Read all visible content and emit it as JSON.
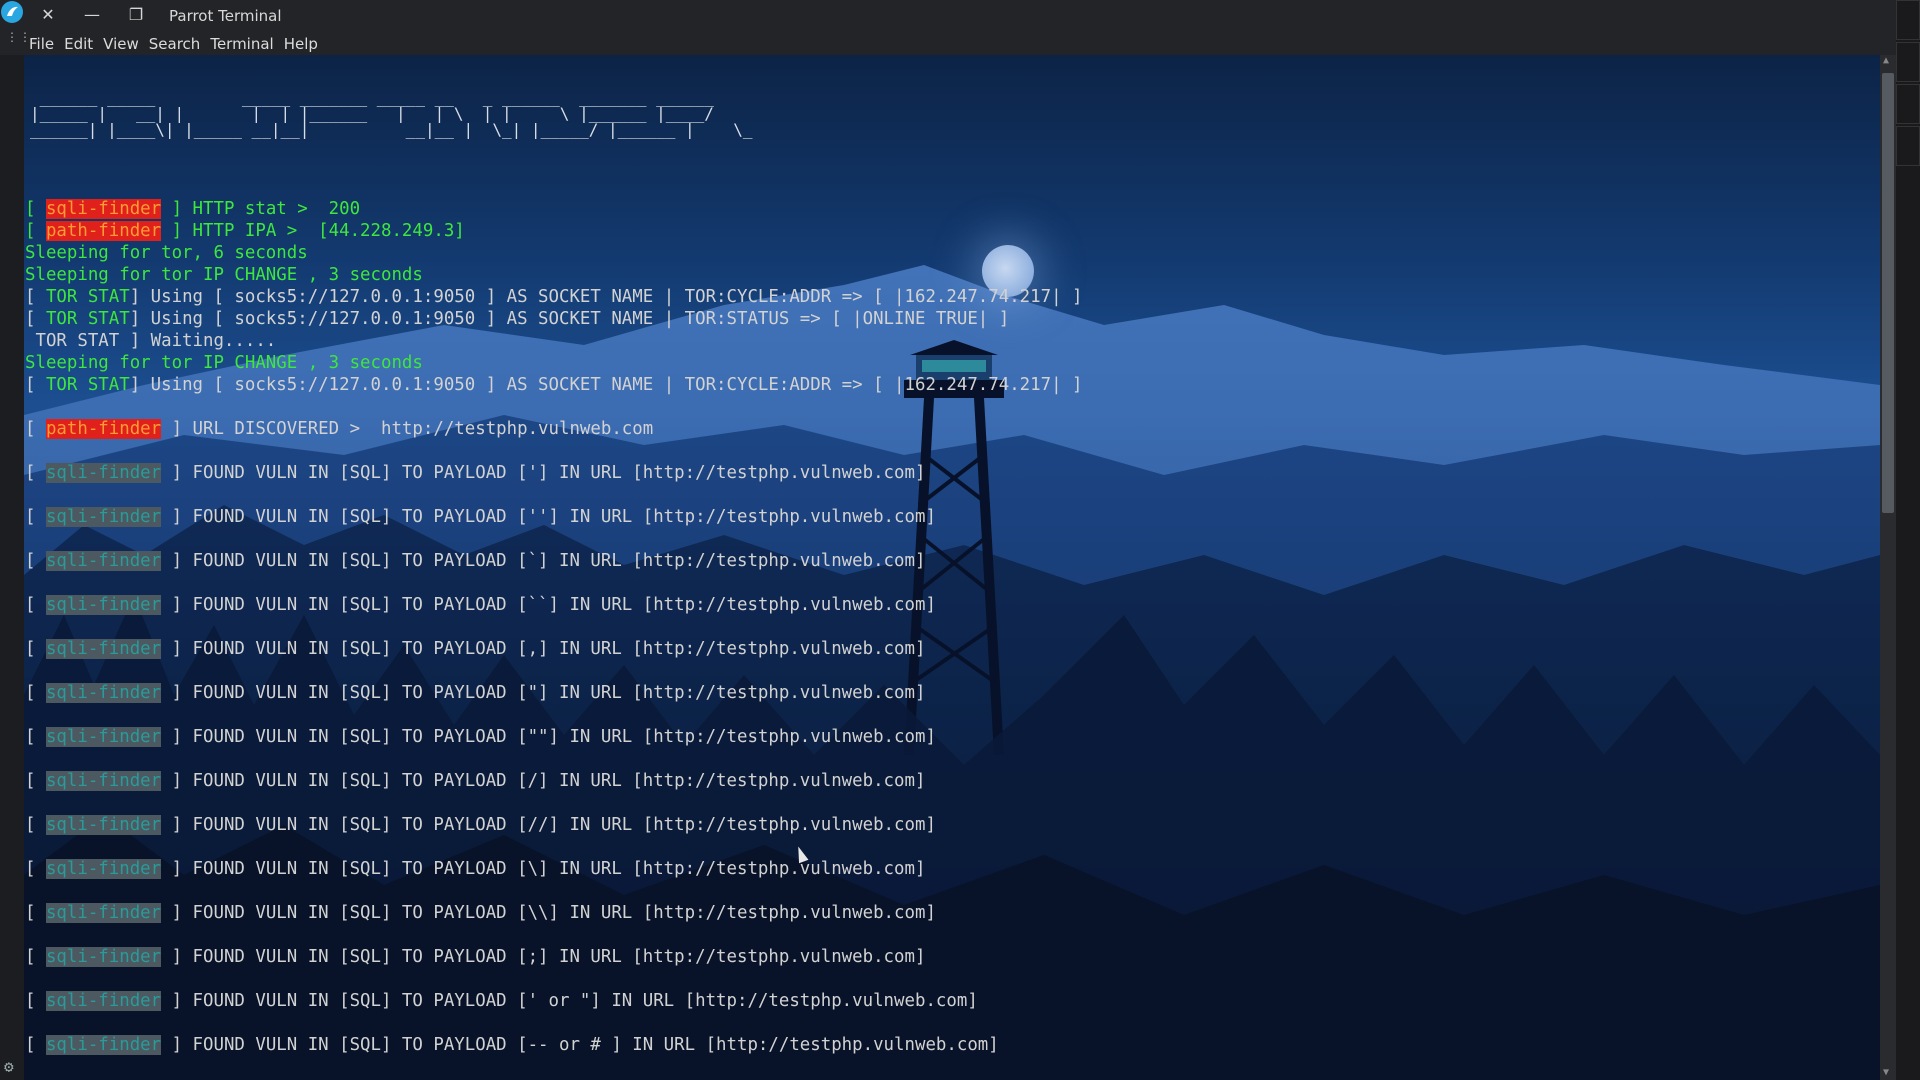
{
  "window": {
    "title": "Parrot Terminal",
    "close_glyph": "✕",
    "minimize_glyph": "—",
    "restore_glyph": "❐"
  },
  "menubar": {
    "items": [
      "File",
      "Edit",
      "View",
      "Search",
      "Terminal",
      "Help"
    ]
  },
  "banner": {
    "line1": " ______ _____         _____ _______ _____ __   _ ______  _______ ______",
    "line2": "|_____ |   __| |       |  | |______   |   | \\  | |     \\ |______ |____/",
    "line3": "______| |____\\| |_____ __|__|          __|__ |  \\_| |_____/ |______ |    \\_"
  },
  "terminal": {
    "lines": [
      {
        "tag": "sqli-finder",
        "style": "red",
        "text": " ] HTTP stat >  200",
        "pre": "[ ",
        "text_color": "green"
      },
      {
        "tag": "path-finder",
        "style": "red",
        "text": " ] HTTP IPA >  [44.228.249.3]",
        "pre": "[ ",
        "text_color": "green"
      },
      {
        "text": "Sleeping for tor, 6 seconds",
        "text_color": "green"
      },
      {
        "text": "Sleeping for tor IP CHANGE , 3 seconds",
        "text_color": "green"
      },
      {
        "tag": "TOR STAT",
        "style": "green",
        "pre": "[ ",
        "text": "] Using [ socks5://127.0.0.1:9050 ] AS SOCKET NAME | TOR:CYCLE:ADDR => [ |162.247.74.217| ]"
      },
      {
        "tag": "TOR STAT",
        "style": "green",
        "pre": "[ ",
        "text": "] Using [ socks5://127.0.0.1:9050 ] AS SOCKET NAME | TOR:STATUS => [ |ONLINE TRUE| ]"
      },
      {
        "text": " TOR STAT ] Waiting....."
      },
      {
        "text": "Sleeping for tor IP CHANGE , 3 seconds",
        "text_color": "green"
      },
      {
        "tag": "TOR STAT",
        "style": "green",
        "pre": "[ ",
        "text": "] Using [ socks5://127.0.0.1:9050 ] AS SOCKET NAME | TOR:CYCLE:ADDR => [ |162.247.74.217| ]"
      },
      {
        "text": ""
      },
      {
        "tag": "path-finder",
        "style": "red",
        "pre": "[ ",
        "text": " ] URL DISCOVERED >  http://testphp.vulnweb.com"
      },
      {
        "text": ""
      },
      {
        "tag": "sqli-finder",
        "style": "grey",
        "pre": "[ ",
        "text": " ] FOUND VULN IN [SQL] TO PAYLOAD ['] IN URL [http://testphp.vulnweb.com]"
      },
      {
        "text": ""
      },
      {
        "tag": "sqli-finder",
        "style": "grey",
        "pre": "[ ",
        "text": " ] FOUND VULN IN [SQL] TO PAYLOAD [''] IN URL [http://testphp.vulnweb.com]"
      },
      {
        "text": ""
      },
      {
        "tag": "sqli-finder",
        "style": "grey",
        "pre": "[ ",
        "text": " ] FOUND VULN IN [SQL] TO PAYLOAD [`] IN URL [http://testphp.vulnweb.com]"
      },
      {
        "text": ""
      },
      {
        "tag": "sqli-finder",
        "style": "grey",
        "pre": "[ ",
        "text": " ] FOUND VULN IN [SQL] TO PAYLOAD [``] IN URL [http://testphp.vulnweb.com]"
      },
      {
        "text": ""
      },
      {
        "tag": "sqli-finder",
        "style": "grey",
        "pre": "[ ",
        "text": " ] FOUND VULN IN [SQL] TO PAYLOAD [,] IN URL [http://testphp.vulnweb.com]"
      },
      {
        "text": ""
      },
      {
        "tag": "sqli-finder",
        "style": "grey",
        "pre": "[ ",
        "text": " ] FOUND VULN IN [SQL] TO PAYLOAD [\"] IN URL [http://testphp.vulnweb.com]"
      },
      {
        "text": ""
      },
      {
        "tag": "sqli-finder",
        "style": "grey",
        "pre": "[ ",
        "text": " ] FOUND VULN IN [SQL] TO PAYLOAD [\"\"] IN URL [http://testphp.vulnweb.com]"
      },
      {
        "text": ""
      },
      {
        "tag": "sqli-finder",
        "style": "grey",
        "pre": "[ ",
        "text": " ] FOUND VULN IN [SQL] TO PAYLOAD [/] IN URL [http://testphp.vulnweb.com]"
      },
      {
        "text": ""
      },
      {
        "tag": "sqli-finder",
        "style": "grey",
        "pre": "[ ",
        "text": " ] FOUND VULN IN [SQL] TO PAYLOAD [//] IN URL [http://testphp.vulnweb.com]"
      },
      {
        "text": ""
      },
      {
        "tag": "sqli-finder",
        "style": "grey",
        "pre": "[ ",
        "text": " ] FOUND VULN IN [SQL] TO PAYLOAD [\\] IN URL [http://testphp.vulnweb.com]"
      },
      {
        "text": ""
      },
      {
        "tag": "sqli-finder",
        "style": "grey",
        "pre": "[ ",
        "text": " ] FOUND VULN IN [SQL] TO PAYLOAD [\\\\] IN URL [http://testphp.vulnweb.com]"
      },
      {
        "text": ""
      },
      {
        "tag": "sqli-finder",
        "style": "grey",
        "pre": "[ ",
        "text": " ] FOUND VULN IN [SQL] TO PAYLOAD [;] IN URL [http://testphp.vulnweb.com]"
      },
      {
        "text": ""
      },
      {
        "tag": "sqli-finder",
        "style": "grey",
        "pre": "[ ",
        "text": " ] FOUND VULN IN [SQL] TO PAYLOAD [' or \"] IN URL [http://testphp.vulnweb.com]"
      },
      {
        "text": ""
      },
      {
        "tag": "sqli-finder",
        "style": "grey",
        "pre": "[ ",
        "text": " ] FOUND VULN IN [SQL] TO PAYLOAD [-- or # ] IN URL [http://testphp.vulnweb.com]"
      }
    ]
  },
  "colors": {
    "green_text": "#3ee63e",
    "red_tag_bg": "#e0201b",
    "red_tag_fg": "#ff9a34",
    "grey_tag_bg": "#4c5960",
    "grey_tag_fg": "#2a9a9a"
  }
}
